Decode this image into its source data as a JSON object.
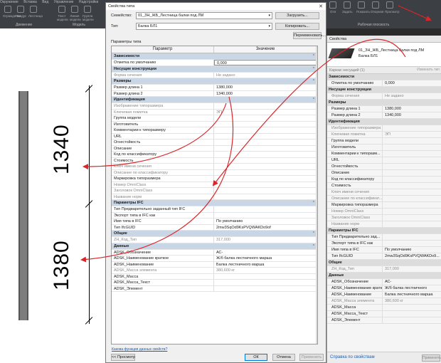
{
  "ribbon": {
    "tabs": [
      "Окружение",
      "Вставка",
      "Вид",
      "Управление",
      "Надстройки",
      "Modify"
    ],
    "groups": [
      {
        "label": "Движение",
        "buttons": [
          "Ограждение",
          "Пандус",
          "Лестница"
        ]
      },
      {
        "label": "Модель",
        "buttons": [
          "Текст модели",
          "Линия модели",
          "Группа модели"
        ]
      }
    ],
    "right_buttons": [
      "Отв",
      "Задать",
      "Показать",
      "Опорная",
      "Просмотр"
    ],
    "right_group_label": "Рабочая плоскость"
  },
  "canvas": {
    "dim_upper": "1340",
    "dim_lower": "1380"
  },
  "properties_panel": {
    "title": "Свойства",
    "type_line1": "01_ЗН_ЖБ_Лестница балки под ЛМ",
    "type_line2": "Балка БЛ1",
    "filter": "Каркас несущий (1)",
    "edit_type": "Изменить тип",
    "rows": [
      {
        "k": "Зависимости",
        "sec": true
      },
      {
        "k": "Отметка по умолчанию",
        "v": "0,000"
      },
      {
        "k": "Несущие конструкции",
        "sec": true
      },
      {
        "k": "Форма сечения",
        "v": "Не задано",
        "dim": true
      },
      {
        "k": "Размеры",
        "sec": true
      },
      {
        "k": "Размер длина 1",
        "v": "1380,000"
      },
      {
        "k": "Размер длина 2",
        "v": "1340,000"
      },
      {
        "k": "Идентификация",
        "sec": true
      },
      {
        "k": "Изображение типоразмера",
        "v": "",
        "dim": true
      },
      {
        "k": "Ключевая пометка",
        "v": "ЭП",
        "dim": true
      },
      {
        "k": "Группа модели",
        "v": ""
      },
      {
        "k": "Изготовитель",
        "v": ""
      },
      {
        "k": "Комментарии к типоразм...",
        "v": ""
      },
      {
        "k": "URL",
        "v": ""
      },
      {
        "k": "Огнестойкость",
        "v": ""
      },
      {
        "k": "Описание",
        "v": ""
      },
      {
        "k": "Код по классификатору",
        "v": ""
      },
      {
        "k": "Стоимость",
        "v": ""
      },
      {
        "k": "Ключ имени сечения",
        "v": "",
        "dim": true
      },
      {
        "k": "Описание по классификат...",
        "v": "",
        "dim": true
      },
      {
        "k": "Маркировка типоразмера",
        "v": ""
      },
      {
        "k": "Номер OmniClass",
        "v": "",
        "dim": true
      },
      {
        "k": "Заголовок OmniClass",
        "v": "",
        "dim": true
      },
      {
        "k": "Название норм",
        "v": "",
        "dim": true
      },
      {
        "k": "Параметры IFC",
        "sec": true
      },
      {
        "k": "Тип Предварительно зад...",
        "v": ""
      },
      {
        "k": "Экспорт типа в IFC как",
        "v": ""
      },
      {
        "k": "Имя типа в IFC",
        "v": "По умолчанию"
      },
      {
        "k": "Тип IfcGUID",
        "v": "2mw3SqOd9KsPVQWAKDo9..."
      },
      {
        "k": "Общие",
        "sec": true
      },
      {
        "k": "ZH_Код_Тип",
        "v": "317,000",
        "dim": true
      },
      {
        "k": "Данные",
        "sec": true
      },
      {
        "k": "ADSK_Обозначение",
        "v": "АС-"
      },
      {
        "k": "ADSK_Наименование кратк...",
        "v": "Ж/б балка лестничного"
      },
      {
        "k": "ADSK_Наименование",
        "v": "Балка лестничного марша"
      },
      {
        "k": "ADSK_Масса элемента",
        "v": "380,600 кг",
        "dim": true
      },
      {
        "k": "ADSK_Масса",
        "v": ""
      },
      {
        "k": "ADSK_Масса_Текст",
        "v": ""
      },
      {
        "k": "ADSK_Элемент",
        "v": ""
      }
    ],
    "help_link": "Справка по свойствам",
    "apply": "Применить"
  },
  "dialog": {
    "title": "Свойства типа",
    "family_label": "Семейство:",
    "family_value": "01_ЗН_ЖБ_Лестница балки под ЛМ",
    "type_label": "Тип:",
    "type_value": "Балка БЛ1",
    "load_button": "Загрузить...",
    "copy_button": "Копировать...",
    "rename_button": "Переименовать...",
    "params_label": "Параметры типа",
    "col_param": "Параметр",
    "col_value": "Значение",
    "rows": [
      {
        "k": "Зависимости",
        "sec": true
      },
      {
        "k": "Отметка по умолчанию",
        "v": "0,000",
        "box": true
      },
      {
        "k": "Несущие конструкции",
        "sec": true
      },
      {
        "k": "Форма сечения",
        "v": "Не задано",
        "dim": true
      },
      {
        "k": "Размеры",
        "sec": true
      },
      {
        "k": "Размер длина 1",
        "v": "1380,000"
      },
      {
        "k": "Размер длина 2",
        "v": "1340,000"
      },
      {
        "k": "Идентификация",
        "sec": true
      },
      {
        "k": "Изображение типоразмера",
        "v": "",
        "dim": true
      },
      {
        "k": "Ключевая пометка",
        "v": "ЭП",
        "dim": true
      },
      {
        "k": "Группа модели",
        "v": ""
      },
      {
        "k": "Изготовитель",
        "v": ""
      },
      {
        "k": "Комментарии к типоразмеру",
        "v": ""
      },
      {
        "k": "URL",
        "v": ""
      },
      {
        "k": "Огнестойкость",
        "v": ""
      },
      {
        "k": "Описание",
        "v": ""
      },
      {
        "k": "Код по классификатору",
        "v": ""
      },
      {
        "k": "Стоимость",
        "v": ""
      },
      {
        "k": "Ключ имени сечения",
        "v": "",
        "dim": true
      },
      {
        "k": "Описание по классификатору",
        "v": "",
        "dim": true
      },
      {
        "k": "Маркировка типоразмера",
        "v": ""
      },
      {
        "k": "Номер OmniClass",
        "v": "",
        "dim": true
      },
      {
        "k": "Заголовок OmniClass",
        "v": "",
        "dim": true
      },
      {
        "k": "Название норм",
        "v": "",
        "dim": true
      },
      {
        "k": "Параметры IFC",
        "sec": true
      },
      {
        "k": "Тип Предварительно заданный тип IFC",
        "v": ""
      },
      {
        "k": "Экспорт типа в IFC как",
        "v": ""
      },
      {
        "k": "Имя типа в IFC",
        "v": "По умолчанию"
      },
      {
        "k": "Тип IfcGUID",
        "v": "2mw3SqOd9KsPVQWAKDo9of"
      },
      {
        "k": "Общие",
        "sec": true
      },
      {
        "k": "ZH_Код_Тип",
        "v": "317,000",
        "dim": true
      },
      {
        "k": "Данные",
        "sec": true
      },
      {
        "k": "ADSK_Обозначение",
        "v": "АС-"
      },
      {
        "k": "ADSK_Наименование краткое",
        "v": "Ж/б балка лестничного марша"
      },
      {
        "k": "ADSK_Наименование",
        "v": "Балка лестничного марша"
      },
      {
        "k": "ADSK_Масса элемента",
        "v": "380,600 кг",
        "dim": true
      },
      {
        "k": "ADSK_Масса",
        "v": ""
      },
      {
        "k": "ADSK_Масса_Текст",
        "v": ""
      },
      {
        "k": "ADSK_Элемент",
        "v": ""
      }
    ],
    "help_link": "Какова функция данных свойств?",
    "preview_button": "<< Просмотр",
    "ok_button": "ОК",
    "cancel_button": "Отмена",
    "apply_button": "Применить"
  },
  "colors": {
    "section_header": "#c8d6e6",
    "arrow": "#d9262a",
    "link": "#1a5fb4"
  }
}
